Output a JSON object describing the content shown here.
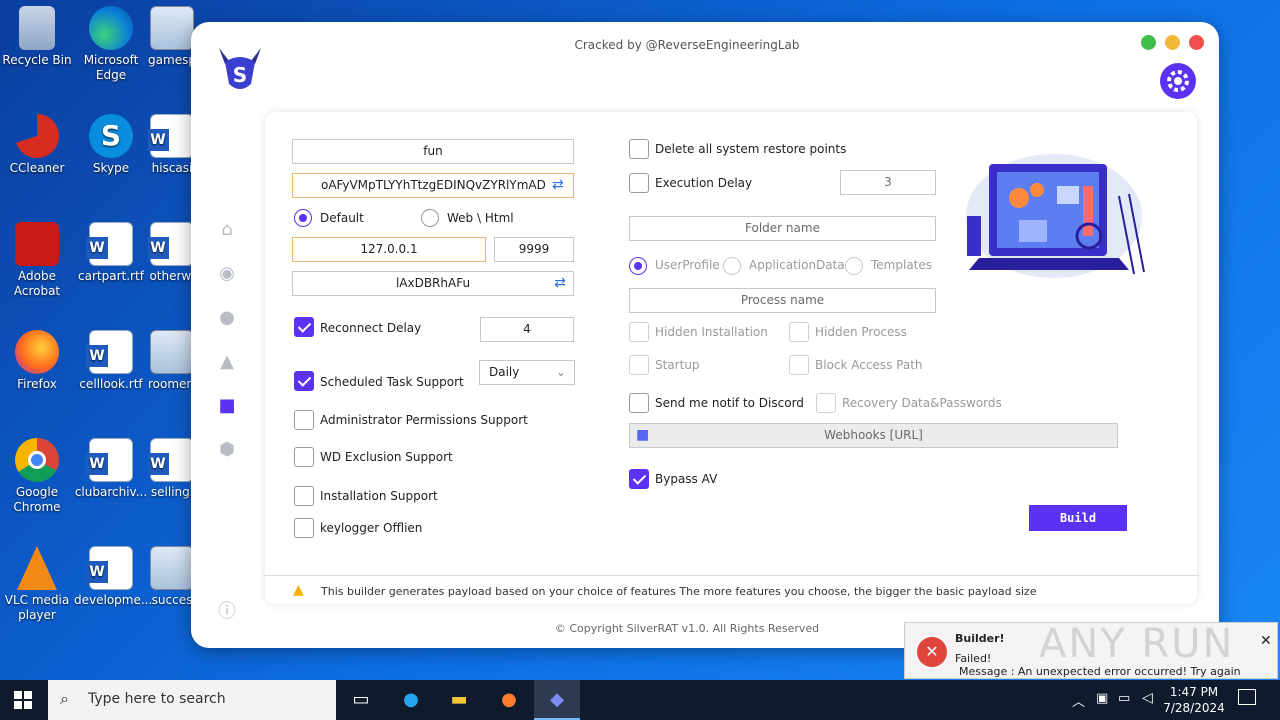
{
  "desktop": {
    "icons": [
      {
        "label": "Recycle Bin",
        "x": "c1",
        "type": "bin"
      },
      {
        "label": "Microsoft Edge",
        "type": "edge"
      },
      {
        "label": "gamesp",
        "type": "img"
      },
      {
        "label": "CCleaner",
        "type": "cc"
      },
      {
        "label": "Skype",
        "type": "skype"
      },
      {
        "label": "hiscasi",
        "type": "doc"
      },
      {
        "label": "Adobe Acrobat",
        "type": "pdf"
      },
      {
        "label": "cartpart.rtf",
        "type": "doc"
      },
      {
        "label": "otherwi",
        "type": "doc"
      },
      {
        "label": "Firefox",
        "type": "ff"
      },
      {
        "label": "celllook.rtf",
        "type": "doc"
      },
      {
        "label": "roomeng",
        "type": "img"
      },
      {
        "label": "Google Chrome",
        "type": "chrome"
      },
      {
        "label": "clubarchiv...",
        "type": "doc"
      },
      {
        "label": "sellingi",
        "type": "doc"
      },
      {
        "label": "VLC media player",
        "type": "vlc"
      },
      {
        "label": "developme...",
        "type": "doc"
      },
      {
        "label": "succes",
        "type": "img"
      }
    ]
  },
  "window": {
    "title": "Cracked by @ReverseEngineeringLab",
    "copyright": "© Copyright SilverRAT v1.0. All Rights Reserved"
  },
  "left": {
    "tag_value": "fun",
    "mutex_value": "oAFyVMpTLYYhTtzgEDINQvZYRlYmAD",
    "radio_default": "Default",
    "radio_web": "Web \\ Html",
    "ip_value": "127.0.0.1",
    "port_value": "9999",
    "key_value": "lAxDBRhAFu",
    "reconnect_label": "Reconnect Delay",
    "reconnect_value": "4",
    "schedule_label": "Scheduled Task Support",
    "schedule_option": "Daily",
    "admin_label": "Administrator Permissions Support",
    "wd_label": "WD Exclusion Support",
    "install_label": "Installation Support",
    "keylogger_label": "keylogger Offlien"
  },
  "right": {
    "restore_label": "Delete all system restore points",
    "exec_label": "Execution Delay",
    "exec_value": "3",
    "folder_placeholder": "Folder name",
    "r_user": "UserProfile",
    "r_app": "ApplicationData",
    "r_tpl": "Templates",
    "process_placeholder": "Process name",
    "hidden_install": "Hidden Installation",
    "hidden_process": "Hidden Process",
    "startup": "Startup",
    "block_path": "Block Access Path",
    "discord_label": "Send me notif to Discord",
    "recovery_label": "Recovery Data&Passwords",
    "webhook_placeholder": "Webhooks [URL]",
    "bypass_label": "Bypass AV",
    "build_label": "Build"
  },
  "footer_note": "This builder generates payload based on your choice of features The more features you choose, the bigger the basic payload size",
  "toast": {
    "title": "Builder!",
    "line1": "Failed!",
    "line2": "Message : An unexpected error occurred! Try again",
    "watermark": "ANY RUN"
  },
  "taskbar": {
    "search_placeholder": "Type here to search",
    "time": "1:47 PM",
    "date": "7/28/2024"
  },
  "colors": {
    "accent": "#5b32f2",
    "field_border_orange": "#f1b26b"
  }
}
